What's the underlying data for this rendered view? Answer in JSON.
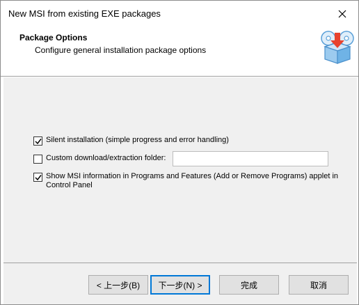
{
  "window": {
    "title": "New MSI from existing EXE packages"
  },
  "header": {
    "title": "Package Options",
    "subtitle": "Configure general installation package options",
    "icon": "package-download-icon"
  },
  "options": {
    "silent": {
      "label": "Silent installation (simple progress and error handling)",
      "checked": true
    },
    "custom_folder": {
      "label": "Custom download/extraction folder:",
      "checked": false,
      "value": "",
      "placeholder": ""
    },
    "show_msi_info": {
      "label_line1": "Show MSI information in Programs and Features (Add or Remove Programs) applet in",
      "label_line2": "Control Panel",
      "checked": true
    }
  },
  "buttons": {
    "back": "< 上一步(B)",
    "next": "下一步(N) >",
    "finish": "完成",
    "cancel": "取消"
  },
  "colors": {
    "content_bg": "#f0f0f0",
    "default_button_border": "#0078d7",
    "icon_accent": "#e8432e",
    "icon_box": "#6fb3e6"
  }
}
